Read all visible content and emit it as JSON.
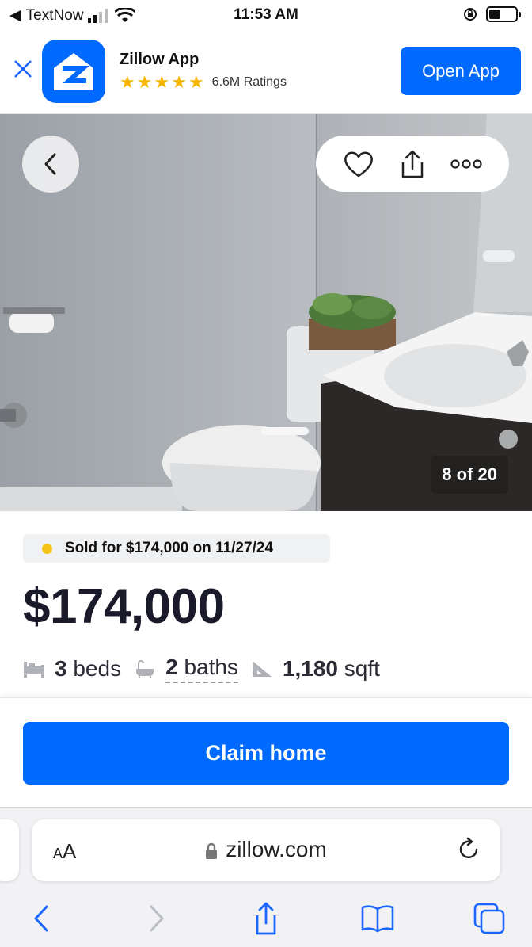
{
  "status_bar": {
    "carrier": "TextNow",
    "time": "11:53 AM",
    "battery_level": 0.45
  },
  "banner": {
    "app_name": "Zillow App",
    "stars": 5,
    "ratings": "6.6M Ratings",
    "open_label": "Open App",
    "colors": {
      "brand": "#006aff",
      "star": "#f7b500"
    }
  },
  "photo": {
    "counter": "8 of 20",
    "icons": [
      "chevron-left-icon",
      "heart-icon",
      "share-icon",
      "more-icon"
    ]
  },
  "listing": {
    "sold_text": "Sold for $174,000 on 11/27/24",
    "price": "$174,000",
    "beds_num": "3",
    "beds_label": "beds",
    "baths_num": "2",
    "baths_label": "baths",
    "sqft_num": "1,180",
    "sqft_label": "sqft",
    "colors": {
      "sold_dot": "#f5c518"
    }
  },
  "cta": {
    "claim_label": "Claim home"
  },
  "browser": {
    "aa_label": "AA",
    "url": "zillow.com",
    "toolbar_icons": [
      "back-icon",
      "forward-icon",
      "share-icon",
      "bookmarks-icon",
      "tabs-icon"
    ]
  }
}
